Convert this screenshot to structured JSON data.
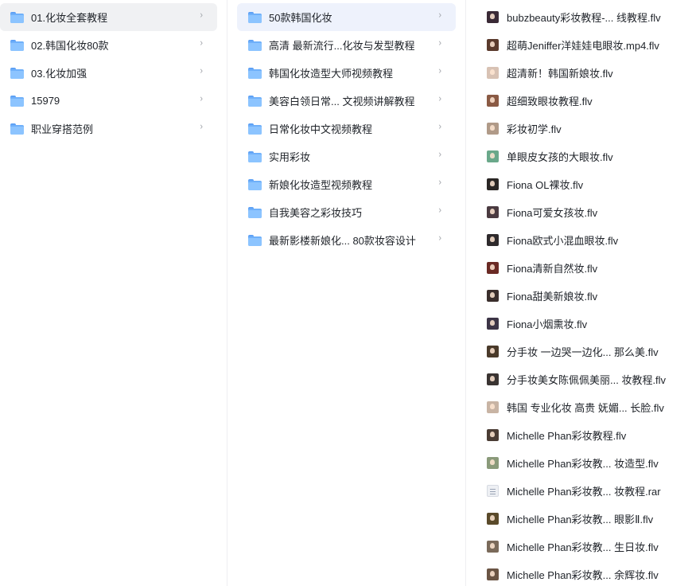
{
  "column1": {
    "items": [
      {
        "label": "01.化妆全套教程",
        "selected": true
      },
      {
        "label": "02.韩国化妆80款"
      },
      {
        "label": "03.化妆加强"
      },
      {
        "label": "15979"
      },
      {
        "label": "职业穿搭范例"
      }
    ]
  },
  "column2": {
    "items": [
      {
        "label": "50款韩国化妆",
        "selected": true
      },
      {
        "label": "高清 最新流行...化妆与发型教程"
      },
      {
        "label": "韩国化妆造型大师视频教程"
      },
      {
        "label": "美容白领日常... 文视频讲解教程"
      },
      {
        "label": "日常化妆中文视频教程"
      },
      {
        "label": "实用彩妆"
      },
      {
        "label": "新娘化妆造型视频教程"
      },
      {
        "label": "自我美容之彩妆技巧"
      },
      {
        "label": "最新影楼新娘化... 80款妆容设计"
      }
    ]
  },
  "column3": {
    "items": [
      {
        "label": "bubzbeauty彩妆教程-... 线教程.flv",
        "thumb": "#3a2a36"
      },
      {
        "label": "超萌Jeniffer洋娃娃电眼妆.mp4.flv",
        "thumb": "#5a3a2c"
      },
      {
        "label": "超清新！韩国新娘妆.flv",
        "thumb": "#d8c2b4"
      },
      {
        "label": "超细致眼妆教程.flv",
        "thumb": "#8a5a44"
      },
      {
        "label": "彩妆初学.flv",
        "thumb": "#b09a88"
      },
      {
        "label": "单眼皮女孩的大眼妆.flv",
        "thumb": "#6aa88a"
      },
      {
        "label": "Fiona OL裸妆.flv",
        "thumb": "#2a2624"
      },
      {
        "label": "Fiona可爱女孩妆.flv",
        "thumb": "#4a3a40"
      },
      {
        "label": "Fiona欧式小混血眼妆.flv",
        "thumb": "#2e2a2c"
      },
      {
        "label": "Fiona清新自然妆.flv",
        "thumb": "#6a2a24"
      },
      {
        "label": "Fiona甜美新娘妆.flv",
        "thumb": "#3a2e2c"
      },
      {
        "label": "Fiona小烟熏妆.flv",
        "thumb": "#3c3446"
      },
      {
        "label": "分手妆 一边哭一边化...  那么美.flv",
        "thumb": "#4a3a2a"
      },
      {
        "label": "分手妆美女陈佩佩美丽... 妆教程.flv",
        "thumb": "#3a3432"
      },
      {
        "label": "韩国 专业化妆 高贵 妩媚... 长脸.flv",
        "thumb": "#c8b4a4"
      },
      {
        "label": "Michelle Phan彩妆教程.flv",
        "thumb": "#4a3c34"
      },
      {
        "label": "Michelle Phan彩妆教...  妆造型.flv",
        "thumb": "#8a9a7a"
      },
      {
        "label": "Michelle Phan彩妆教...  妆教程.rar",
        "thumb": "rar"
      },
      {
        "label": "Michelle Phan彩妆教...  眼影Ⅱ.flv",
        "thumb": "#5a4a2a"
      },
      {
        "label": "Michelle Phan彩妆教...  生日妆.flv",
        "thumb": "#7a6a5a"
      },
      {
        "label": "Michelle Phan彩妆教...  余辉妆.flv",
        "thumb": "#6a5444"
      }
    ]
  },
  "icons": {
    "folder": "folder-icon",
    "chevron": "chevron-right-icon",
    "chevron_glyph": "›",
    "file": "video-thumbnail-icon",
    "archive": "archive-file-icon"
  },
  "colors": {
    "selected_gray": "#f0f1f3",
    "selected_blue": "#eef2fc",
    "folder_blue": "#6fb0fa"
  }
}
